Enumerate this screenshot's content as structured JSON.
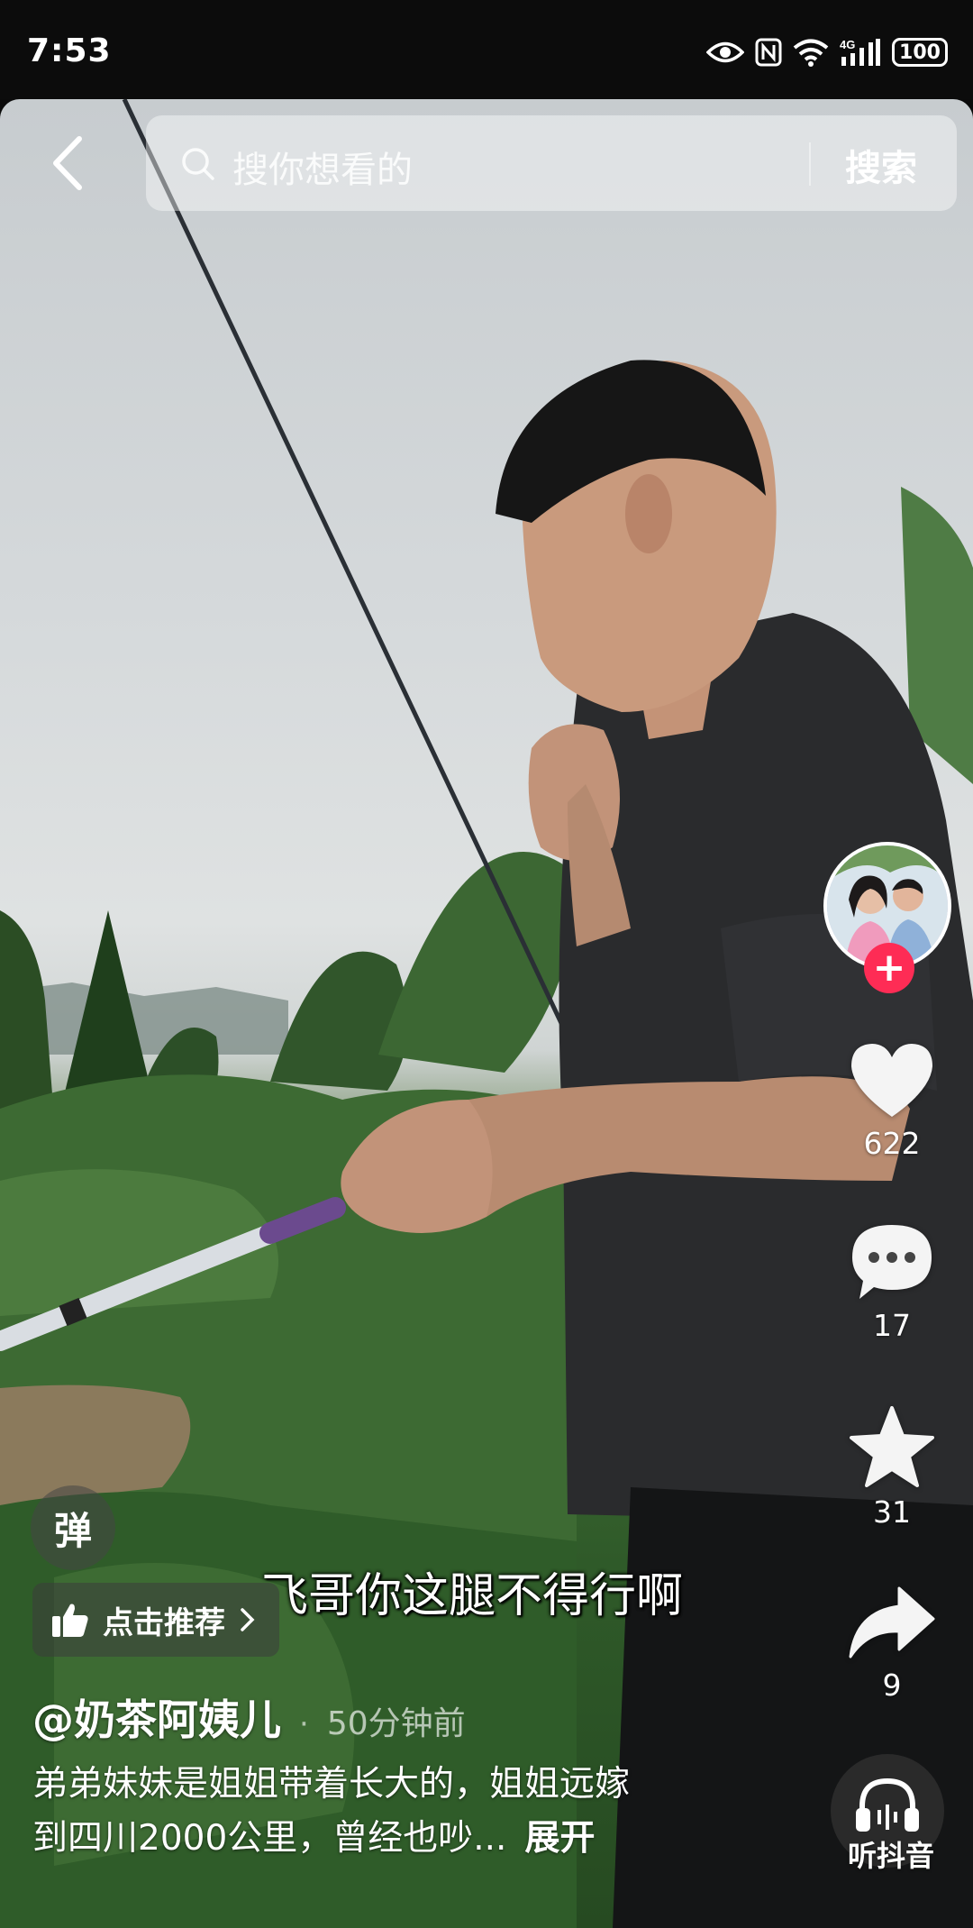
{
  "status_bar": {
    "time": "7:53",
    "battery": "100"
  },
  "search": {
    "placeholder": "搜你想看的",
    "button_label": "搜索"
  },
  "actions": {
    "likes": "622",
    "comments": "17",
    "favorites": "31",
    "shares": "9",
    "listen_label": "听抖音"
  },
  "overlay": {
    "danmu_label": "弹",
    "recommend_label": "点击推荐",
    "subtitle": "飞哥你这腿不得行啊"
  },
  "post": {
    "author": "@奶茶阿姨儿",
    "separator": "·",
    "time_ago": "50分钟前",
    "description_line1": "弟弟妹妹是姐姐带着长大的，姐姐远嫁",
    "description_line2": "到四川2000公里，曾经也吵...",
    "expand_label": "展开"
  },
  "colors": {
    "follow_accent": "#fe2c55",
    "background": "#0c0c0c"
  },
  "icons": [
    "back-arrow-icon",
    "search-icon",
    "heart-icon",
    "comment-icon",
    "star-icon",
    "share-icon",
    "headphones-icon",
    "thumbs-up-icon",
    "eye-icon",
    "nfc-icon",
    "wifi-icon",
    "signal-icon"
  ]
}
